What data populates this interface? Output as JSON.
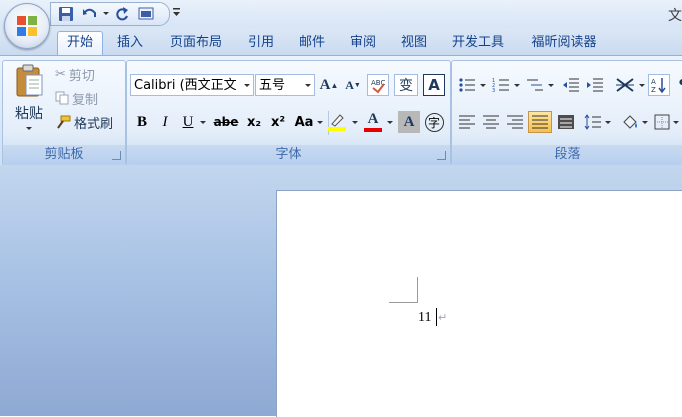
{
  "window": {
    "title_fragment": "文"
  },
  "quick_access": {
    "items": [
      {
        "icon": "save-icon"
      },
      {
        "icon": "undo-icon"
      },
      {
        "icon": "redo-icon"
      },
      {
        "icon": "print-preview-icon"
      }
    ]
  },
  "tabs": [
    {
      "label": "开始",
      "active": true
    },
    {
      "label": "插入"
    },
    {
      "label": "页面布局"
    },
    {
      "label": "引用"
    },
    {
      "label": "邮件"
    },
    {
      "label": "审阅"
    },
    {
      "label": "视图"
    },
    {
      "label": "开发工具"
    },
    {
      "label": "福昕阅读器"
    }
  ],
  "clipboard": {
    "paste_label": "粘贴",
    "cut_label": "剪切",
    "copy_label": "复制",
    "format_painter_label": "格式刷",
    "group_label": "剪贴板"
  },
  "font": {
    "font_name": "Calibri (西文正文",
    "font_size": "五号",
    "group_label": "字体",
    "bold_label": "B",
    "italic_label": "I",
    "underline_label": "U",
    "strike_label": "abe",
    "subscript_label": "x₂",
    "superscript_label": "x²",
    "change_case_label": "Aa",
    "grow_label": "A",
    "shrink_label": "A",
    "phonetic_label": "变",
    "border_char_label": "A",
    "shade_char_label": "A",
    "enclose_label": "字",
    "highlight_color": "#ffff00",
    "font_color": "#e60000"
  },
  "paragraph": {
    "group_label": "段落"
  },
  "document": {
    "text": "11"
  }
}
